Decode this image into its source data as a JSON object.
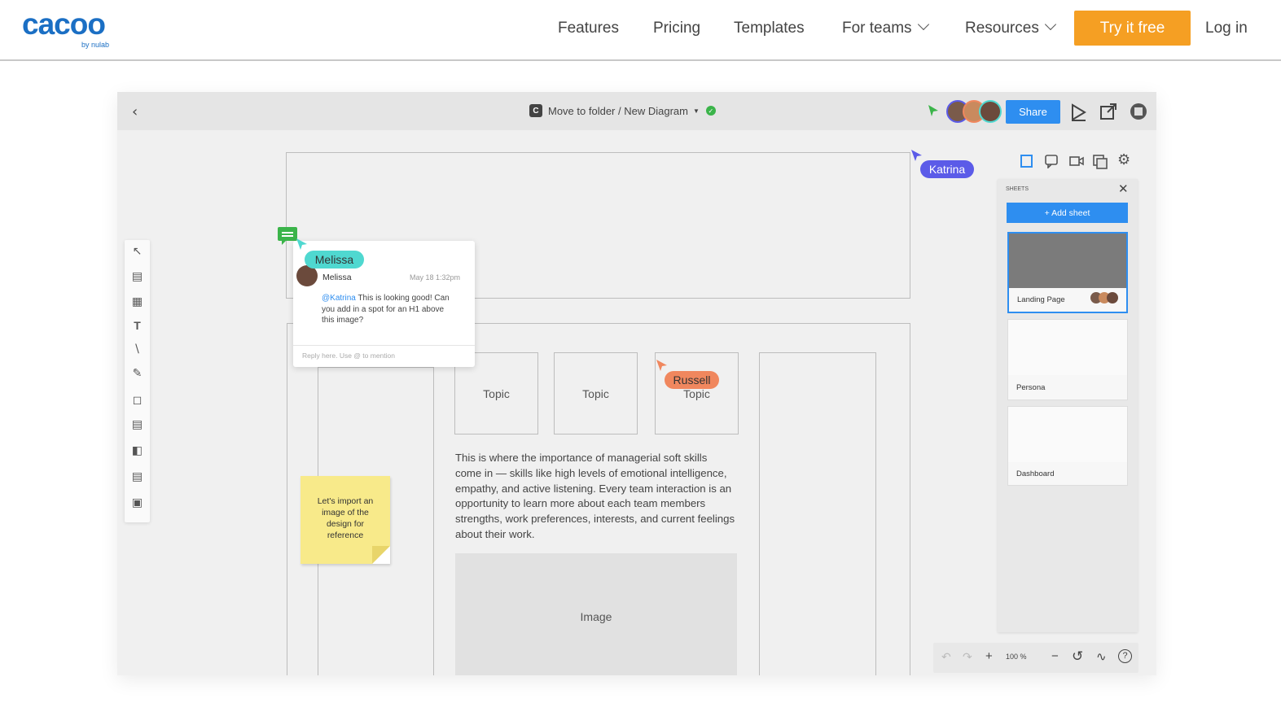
{
  "nav": {
    "logo": "cacoo",
    "logo_by": "by nulab",
    "links": [
      "Features",
      "Pricing",
      "Templates",
      "For teams",
      "Resources"
    ],
    "try_label": "Try it free",
    "login_label": "Log in"
  },
  "app": {
    "breadcrumb": "Move to folder / New Diagram",
    "share_label": "Share",
    "sticky_note": "Let's import an image of the design for reference",
    "topics": [
      "Topic",
      "Topic",
      "Topic"
    ],
    "paragraph": "This is where the importance of managerial soft skills come in — skills like high levels of emotional intelligence, empathy, and active listening. Every team interaction is an opportunity to learn more about each team members strengths, work preferences, interests, and current feelings about their work.",
    "image_label": "Image",
    "cursors": {
      "katrina": "Katrina",
      "melissa": "Melissa",
      "russell": "Russell"
    },
    "comment": {
      "author": "Melissa",
      "date": "May 18 1:32pm",
      "mention": "@Katrina",
      "text": " This is looking good! Can you add in a spot for an H1 above this image?",
      "reply_placeholder": "Reply here. Use @ to mention"
    },
    "sheets_panel": {
      "title": "SHEETS",
      "add_label": "+ Add sheet",
      "sheets": [
        "Landing Page",
        "Persona",
        "Dashboard"
      ]
    },
    "zoom": "100 %"
  },
  "colors": {
    "accent": "#f59f23",
    "brand": "#1b6fc4",
    "share": "#2e8ef0",
    "katrina": "#5b5be8",
    "melissa": "#4fd8d0",
    "russell": "#f0875e",
    "sticky": "#f8ea8a"
  }
}
